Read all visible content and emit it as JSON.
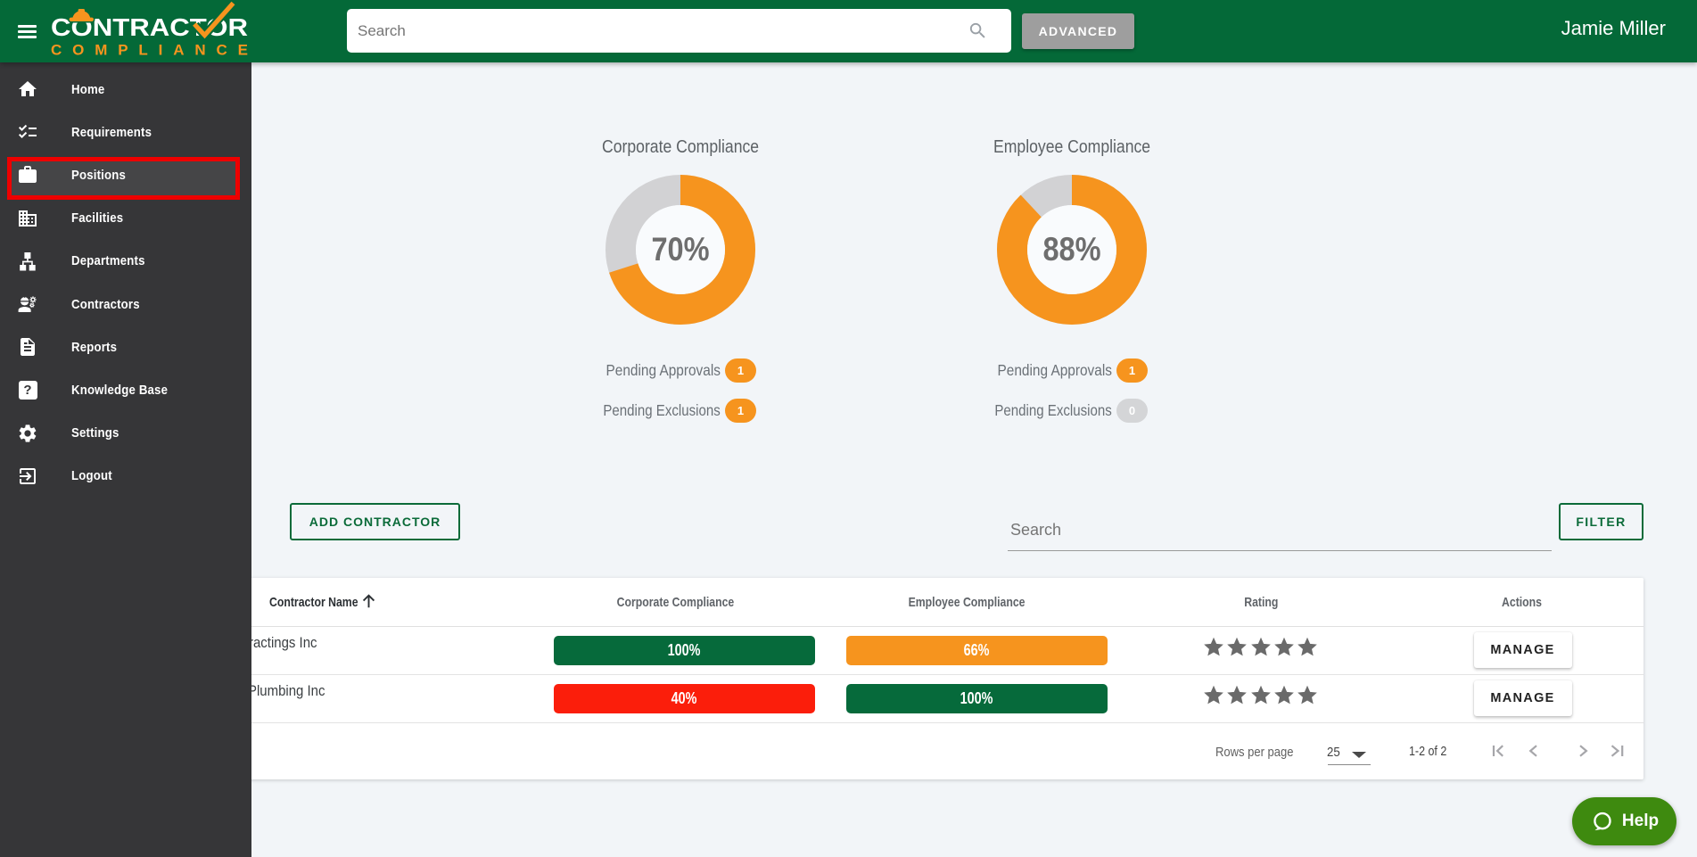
{
  "header": {
    "logo_line1": "CONTRACTOR",
    "logo_line2": "COMPLIANCE",
    "search_placeholder": "Search",
    "advanced_label": "ADVANCED",
    "user_name": "Jamie Miller"
  },
  "sidebar": {
    "items": [
      {
        "label": "Home",
        "icon": "home"
      },
      {
        "label": "Requirements",
        "icon": "checklist"
      },
      {
        "label": "Positions",
        "icon": "briefcase",
        "active": true,
        "annotated": true
      },
      {
        "label": "Facilities",
        "icon": "building"
      },
      {
        "label": "Departments",
        "icon": "org-tree"
      },
      {
        "label": "Contractors",
        "icon": "worker-gear"
      },
      {
        "label": "Reports",
        "icon": "document"
      },
      {
        "label": "Knowledge Base",
        "icon": "question-square"
      },
      {
        "label": "Settings",
        "icon": "gear"
      },
      {
        "label": "Logout",
        "icon": "exit"
      }
    ]
  },
  "chart_data": [
    {
      "type": "donut",
      "title": "Corporate Compliance",
      "value": 70,
      "center_label": "70%",
      "color_filled": "#f6941e",
      "color_rest": "#d2d2d4",
      "pending_approvals_label": "Pending Approvals",
      "pending_approvals_count": "1",
      "pending_approvals_badge": "orange",
      "pending_exclusions_label": "Pending Exclusions",
      "pending_exclusions_count": "1",
      "pending_exclusions_badge": "orange"
    },
    {
      "type": "donut",
      "title": "Employee Compliance",
      "value": 88,
      "center_label": "88%",
      "color_filled": "#f6941e",
      "color_rest": "#d2d2d4",
      "pending_approvals_label": "Pending Approvals",
      "pending_approvals_count": "1",
      "pending_approvals_badge": "orange",
      "pending_exclusions_label": "Pending Exclusions",
      "pending_exclusions_count": "0",
      "pending_exclusions_badge": "gray"
    }
  ],
  "toolbar": {
    "add_contractor_label": "ADD CONTRACTOR",
    "search_placeholder": "Search",
    "filter_label": "FILTER"
  },
  "table": {
    "columns": {
      "name": "Contractor Name",
      "corporate": "Corporate Compliance",
      "employee": "Employee Compliance",
      "rating": "Rating",
      "actions": "Actions"
    },
    "rows": [
      {
        "name": "ractings Inc",
        "corporate": "100%",
        "corporate_color": "c-green",
        "employee": "66%",
        "employee_color": "c-orange",
        "rating": 5,
        "action_label": "MANAGE"
      },
      {
        "name": "Plumbing Inc",
        "corporate": "40%",
        "corporate_color": "c-red",
        "employee": "100%",
        "employee_color": "c-green",
        "rating": 5,
        "action_label": "MANAGE"
      }
    ],
    "footer": {
      "rows_per_page_label": "Rows per page",
      "rows_per_page_value": "25",
      "range_label": "1-2 of 2"
    }
  },
  "help": {
    "label": "Help"
  }
}
